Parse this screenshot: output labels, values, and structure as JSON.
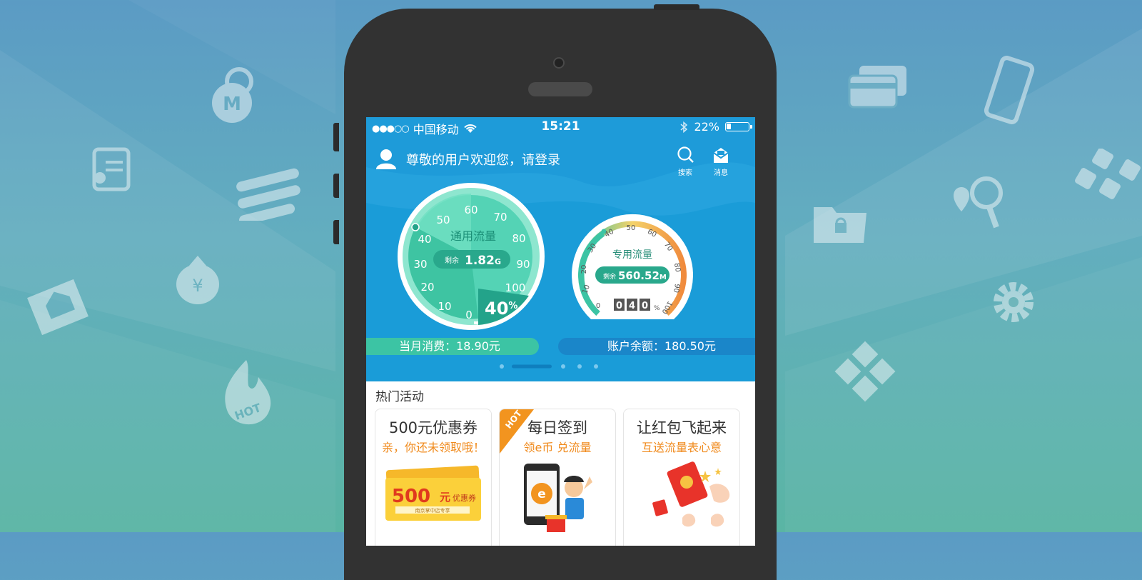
{
  "status_bar": {
    "signal": "●●●○○",
    "carrier": "中国移动",
    "time": "15:21",
    "battery": "22%",
    "battery_level": 0.22
  },
  "header": {
    "welcome": "尊敬的用户欢迎您，请登录",
    "search_label": "搜索",
    "message_label": "消息"
  },
  "gauge_general": {
    "title": "通用流量",
    "remaining_label": "剩余",
    "remaining_value": "1.82",
    "remaining_unit": "G",
    "percent": "40",
    "percent_sign": "%",
    "ticks": [
      "0",
      "10",
      "20",
      "30",
      "40",
      "50",
      "60",
      "70",
      "80",
      "90",
      "100"
    ]
  },
  "gauge_special": {
    "title": "专用流量",
    "remaining_label": "剩余",
    "remaining_value": "560.52",
    "remaining_unit": "M",
    "digits": [
      "0",
      "4",
      "0"
    ],
    "percent_sign": "%",
    "ticks": [
      "0",
      "10",
      "20",
      "30",
      "40",
      "50",
      "60",
      "70",
      "80",
      "90",
      "100"
    ]
  },
  "summary": {
    "monthly_spend": "当月消费：18.90元",
    "balance": "账户余额：180.50元"
  },
  "carousel": {
    "count": 5,
    "active": 1
  },
  "hot_section": {
    "title": "热门活动",
    "cards": [
      {
        "title": "500元优惠券",
        "subtitle": "亲，你还未领取哦！",
        "coupon_amount": "500",
        "coupon_unit": "元",
        "coupon_label": "优惠券",
        "coupon_note": "南京掌中店专享"
      },
      {
        "title": "每日签到",
        "subtitle": "领e币 兑流量",
        "badge": "HOT",
        "e_letter": "e"
      },
      {
        "title": "让红包飞起来",
        "subtitle": "互送流量表心意"
      }
    ]
  },
  "colors": {
    "blue": "#1e9bd9",
    "teal": "#3cc4a4",
    "orange": "#f08a1c"
  }
}
